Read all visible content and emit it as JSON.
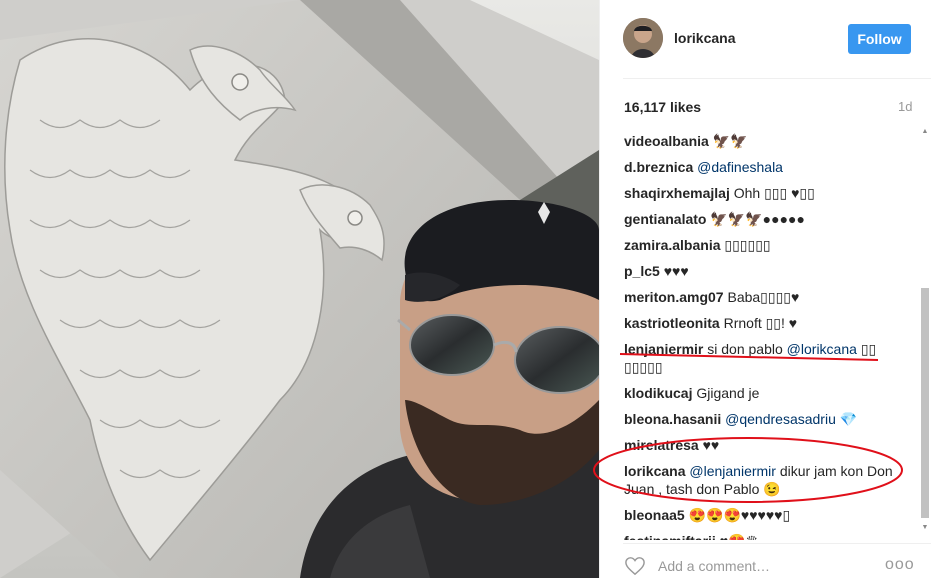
{
  "post": {
    "username": "lorikcana",
    "follow_label": "Follow",
    "likes": "16,117 likes",
    "time_ago": "1d",
    "add_comment_placeholder": "Add a comment…",
    "more_glyph": "ooo"
  },
  "comments": [
    {
      "user": "videoalbania",
      "text": "🦅🦅"
    },
    {
      "user": "d.breznica",
      "mention": "@dafineshala",
      "text": ""
    },
    {
      "user": "shaqirxhemajlaj",
      "text": "Ohh ▯▯▯ ♥▯▯"
    },
    {
      "user": "gentianalato",
      "text": "🦅🦅🦅●●●●●"
    },
    {
      "user": "zamira.albania",
      "text": "▯▯▯▯▯▯"
    },
    {
      "user": "p_lc5",
      "text": "♥♥♥"
    },
    {
      "user": "meriton.amg07",
      "text": "Baba▯▯▯▯♥"
    },
    {
      "user": "kastriotleonita",
      "text": "Rrnoft ▯▯! ♥"
    },
    {
      "user": "lenjaniermir",
      "text_before": "si don pablo",
      "mention": "@lorikcana",
      "text": "▯▯ ▯▯▯▯▯"
    },
    {
      "user": "klodikucaj",
      "text": "Gjigand je"
    },
    {
      "user": "bleona.hasanii",
      "mention": "@qendresasadriu",
      "text": "💎"
    },
    {
      "user": "mirelatresa",
      "text": "♥♥"
    },
    {
      "user": "lorikcana",
      "mention": "@lenjaniermir",
      "text": "dikur jam kon Don Juan , tash don Pablo 😉"
    },
    {
      "user": "bleonaa5",
      "text": "😍😍😍♥♥♥♥♥▯"
    },
    {
      "user": "festinamiftarii",
      "text": "♥😍♛"
    }
  ],
  "colors": {
    "accent": "#3897f0",
    "mention": "#003569",
    "annotation_red": "#e0101a"
  },
  "icons": {
    "heart": "heart-icon",
    "more": "more-icon",
    "scroll_up": "scroll-up-arrow-icon",
    "scroll_down": "scroll-down-arrow-icon"
  }
}
